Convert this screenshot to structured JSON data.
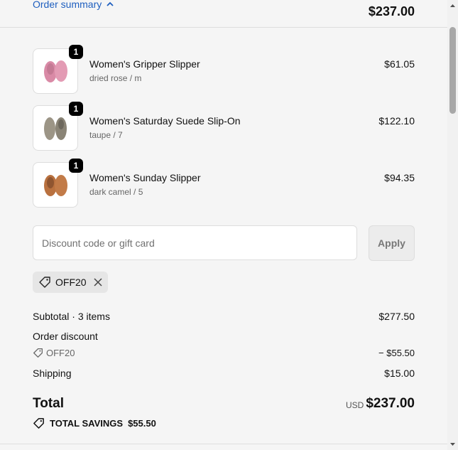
{
  "header": {
    "summary_toggle_label": "Order summary",
    "total": "$237.00"
  },
  "items": [
    {
      "name": "Women's Gripper Slipper",
      "variant": "dried rose / m",
      "price": "$61.05",
      "quantity": "1",
      "color": "#d98aa6"
    },
    {
      "name": "Women's Saturday Suede Slip-On",
      "variant": "taupe / 7",
      "price": "$122.10",
      "quantity": "1",
      "color": "#9c9586"
    },
    {
      "name": "Women's Sunday Slipper",
      "variant": "dark camel / 5",
      "price": "$94.35",
      "quantity": "1",
      "color": "#b9713f"
    }
  ],
  "discount": {
    "placeholder": "Discount code or gift card",
    "value": "",
    "apply_label": "Apply",
    "applied_code": "OFF20"
  },
  "totals": {
    "subtotal_label": "Subtotal · 3 items",
    "subtotal_value": "$277.50",
    "order_discount_label": "Order discount",
    "discount_code": "OFF20",
    "discount_value": "− $55.50",
    "shipping_label": "Shipping",
    "shipping_value": "$15.00",
    "total_label": "Total",
    "currency": "USD",
    "total_value": "$237.00",
    "savings_label": "TOTAL SAVINGS",
    "savings_value": "$55.50"
  },
  "colors": {
    "link": "#1f5fbf",
    "badge": "#000000"
  }
}
